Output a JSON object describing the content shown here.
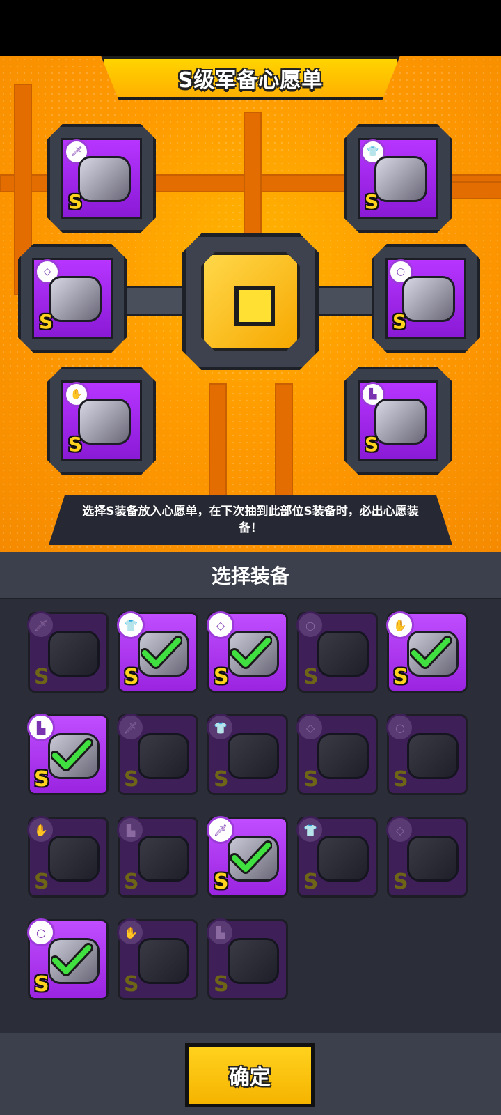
{
  "wishlist": {
    "title": "S级军备心愿单",
    "info": "选择S装备放入心愿单，在下次抽到此部位S装备时，必出心愿装备！",
    "slots": [
      {
        "slot": "weapon",
        "icon": "dagger-icon",
        "grade": "S"
      },
      {
        "slot": "armor",
        "icon": "shirt-icon",
        "grade": "S"
      },
      {
        "slot": "necklace",
        "icon": "necklace-icon",
        "grade": "S"
      },
      {
        "slot": "belt",
        "icon": "ring-icon",
        "grade": "S"
      },
      {
        "slot": "gloves",
        "icon": "glove-icon",
        "grade": "S"
      },
      {
        "slot": "boots",
        "icon": "boot-icon",
        "grade": "S"
      }
    ]
  },
  "selection": {
    "header": "选择装备",
    "items": [
      {
        "slot": "weapon",
        "icon": "dagger-icon",
        "grade": "S",
        "selected": false,
        "active": false
      },
      {
        "slot": "armor",
        "icon": "shirt-icon",
        "grade": "S",
        "selected": true,
        "active": true
      },
      {
        "slot": "necklace",
        "icon": "necklace-icon",
        "grade": "S",
        "selected": true,
        "active": true
      },
      {
        "slot": "belt",
        "icon": "ring-icon",
        "grade": "S",
        "selected": false,
        "active": false
      },
      {
        "slot": "gloves",
        "icon": "glove-icon",
        "grade": "S",
        "selected": true,
        "active": true
      },
      {
        "slot": "boots",
        "icon": "boot-icon",
        "grade": "S",
        "selected": true,
        "active": true
      },
      {
        "slot": "weapon",
        "icon": "dagger-icon",
        "grade": "S",
        "selected": false,
        "active": false
      },
      {
        "slot": "armor",
        "icon": "shirt-icon",
        "grade": "S",
        "selected": false,
        "active": false
      },
      {
        "slot": "necklace",
        "icon": "necklace-icon",
        "grade": "S",
        "selected": false,
        "active": false
      },
      {
        "slot": "belt",
        "icon": "ring-icon",
        "grade": "S",
        "selected": false,
        "active": false
      },
      {
        "slot": "gloves",
        "icon": "glove-icon",
        "grade": "S",
        "selected": false,
        "active": false
      },
      {
        "slot": "boots",
        "icon": "boot-icon",
        "grade": "S",
        "selected": false,
        "active": false
      },
      {
        "slot": "weapon",
        "icon": "dagger-icon",
        "grade": "S",
        "selected": true,
        "active": true
      },
      {
        "slot": "armor",
        "icon": "shirt-icon",
        "grade": "S",
        "selected": false,
        "active": false
      },
      {
        "slot": "necklace",
        "icon": "necklace-icon",
        "grade": "S",
        "selected": false,
        "active": false
      },
      {
        "slot": "belt",
        "icon": "ring-icon",
        "grade": "S",
        "selected": true,
        "active": true
      },
      {
        "slot": "gloves",
        "icon": "glove-icon",
        "grade": "S",
        "selected": false,
        "active": false
      },
      {
        "slot": "boots",
        "icon": "boot-icon",
        "grade": "S",
        "selected": false,
        "active": false
      }
    ]
  },
  "footer": {
    "confirm_label": "确定"
  },
  "colors": {
    "accent": "#ffd21e",
    "purple": "#b735ff",
    "check": "#3fe03f"
  }
}
